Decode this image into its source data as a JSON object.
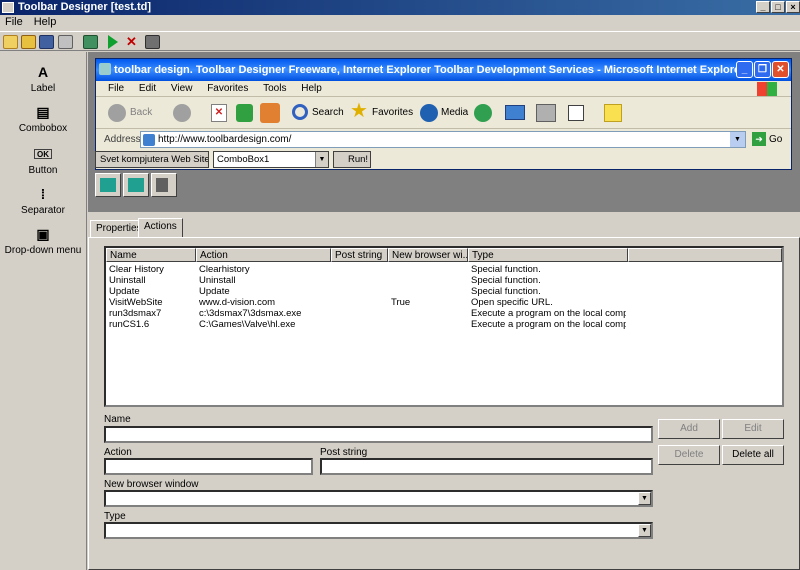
{
  "app": {
    "title": "Toolbar Designer [test.td]"
  },
  "menu": [
    "File",
    "Help"
  ],
  "tools": [
    {
      "label": "Label",
      "glyph": "A"
    },
    {
      "label": "Combobox",
      "glyph": "▤"
    },
    {
      "label": "Button",
      "glyph": "OK"
    },
    {
      "label": "Separator",
      "glyph": "⁞"
    },
    {
      "label": "Drop-down menu",
      "glyph": "▣"
    }
  ],
  "ie": {
    "title": "toolbar design. Toolbar Designer Freeware, Internet Explorer Toolbar Development Services - Microsoft Internet Explorer",
    "menu": [
      "File",
      "Edit",
      "View",
      "Favorites",
      "Tools",
      "Help"
    ],
    "back": "Back",
    "search": "Search",
    "favorites": "Favorites",
    "media": "Media",
    "address_label": "Address",
    "url": "http://www.toolbardesign.com/",
    "go": "Go"
  },
  "custom": {
    "button": "Svet kompjutera Web Site",
    "combo": "ComboBox1",
    "run": "Run!"
  },
  "tabs": [
    "Properties",
    "Actions"
  ],
  "columns": [
    "Name",
    "Action",
    "Post string",
    "New browser wi...",
    "Type"
  ],
  "rows": [
    [
      "Clear History",
      "Clearhistory",
      "",
      "",
      "Special function."
    ],
    [
      "Uninstall",
      "Uninstall",
      "",
      "",
      "Special function."
    ],
    [
      "Update",
      "Update",
      "",
      "",
      "Special function."
    ],
    [
      "VisitWebSite",
      "www.d-vision.com",
      "",
      "True",
      "Open specific URL."
    ],
    [
      "run3dsmax7",
      "c:\\3dsmax7\\3dsmax.exe",
      "",
      "",
      "Execute a program on the local comp..."
    ],
    [
      "runCS1.6",
      "C:\\Games\\Valve\\hl.exe",
      "",
      "",
      "Execute a program on the local comp..."
    ]
  ],
  "form": {
    "name": "Name",
    "action": "Action",
    "post": "Post string",
    "newwin": "New browser window",
    "type": "Type"
  },
  "buttons": {
    "add": "Add",
    "edit": "Edit",
    "delete": "Delete",
    "deleteall": "Delete all"
  }
}
